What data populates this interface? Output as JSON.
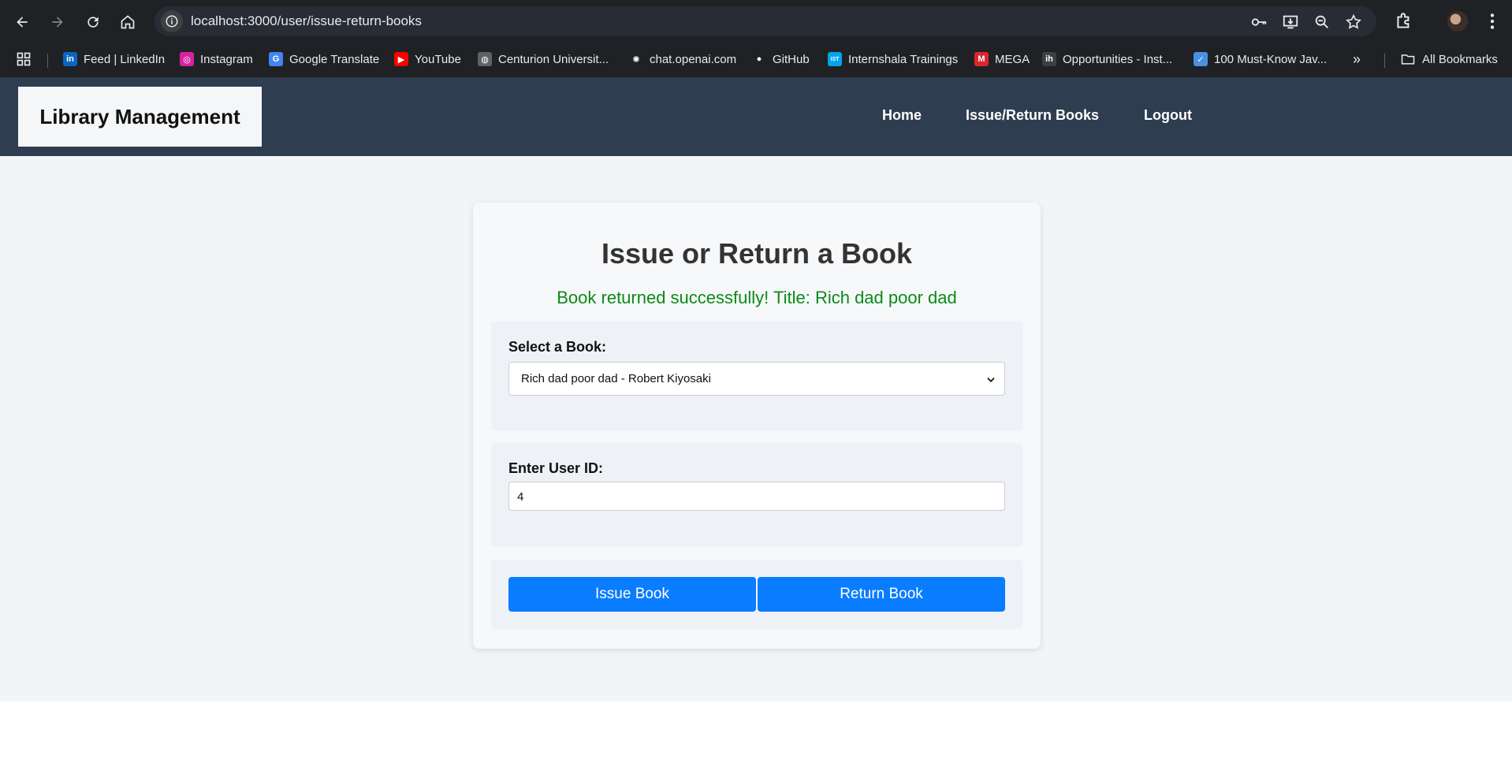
{
  "browser": {
    "url": "localhost:3000/user/issue-return-books",
    "bookmarks": [
      {
        "label": "Feed | LinkedIn",
        "icon": "linkedin-icon",
        "color": "#0a66c2",
        "glyph": "in"
      },
      {
        "label": "Instagram",
        "icon": "instagram-icon",
        "color": "#d6249f",
        "glyph": "◎"
      },
      {
        "label": "Google Translate",
        "icon": "google-translate-icon",
        "color": "#4285f4",
        "glyph": "G"
      },
      {
        "label": "YouTube",
        "icon": "youtube-icon",
        "color": "#ff0000",
        "glyph": "▶"
      },
      {
        "label": "Centurion Universit...",
        "icon": "globe-icon",
        "color": "#5f6368",
        "glyph": "◍"
      },
      {
        "label": "chat.openai.com",
        "icon": "openai-icon",
        "color": "#202124",
        "glyph": "✺"
      },
      {
        "label": "GitHub",
        "icon": "github-icon",
        "color": "#202124",
        "glyph": "●"
      },
      {
        "label": "Internshala Trainings",
        "icon": "internshala-icon",
        "color": "#00a5ec",
        "glyph": "IST"
      },
      {
        "label": "MEGA",
        "icon": "mega-icon",
        "color": "#d9272e",
        "glyph": "M"
      },
      {
        "label": "Opportunities - Inst...",
        "icon": "internshala-ih-icon",
        "color": "#3c4043",
        "glyph": "ih"
      },
      {
        "label": "100 Must-Know Jav...",
        "icon": "verified-check-icon",
        "color": "#4a90e2",
        "glyph": "✓"
      }
    ],
    "all_bookmarks_label": "All Bookmarks"
  },
  "header": {
    "brand": "Library Management",
    "nav": [
      {
        "label": "Home"
      },
      {
        "label": "Issue/Return Books"
      },
      {
        "label": "Logout"
      }
    ]
  },
  "card": {
    "title": "Issue or Return a Book",
    "success_message": "Book returned successfully! Title: Rich dad poor dad",
    "book_label": "Select a Book:",
    "book_selected": "Rich dad poor dad - Robert Kiyosaki",
    "user_label": "Enter User ID:",
    "user_value": "4",
    "issue_button": "Issue Book",
    "return_button": "Return Book"
  },
  "colors": {
    "header_bg": "#2e3d4f",
    "button_bg": "#0a7cff",
    "success_text": "#0a8a16"
  }
}
